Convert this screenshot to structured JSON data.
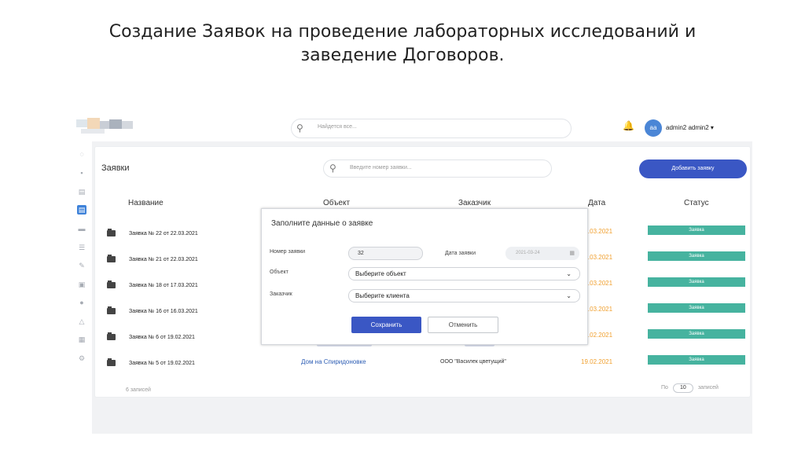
{
  "slide": {
    "title_line1": "Создание Заявок на проведение лабораторных исследований и",
    "title_line2": "заведение Договоров."
  },
  "topbar": {
    "search_placeholder": "Найдется все...",
    "avatar_initials": "aa",
    "username": "admin2 admin2 ▾"
  },
  "sidebar": {
    "icons": [
      "spinner-icon",
      "box-icon",
      "chart-icon",
      "document-icon",
      "folder-icon",
      "list-icon",
      "edit-icon",
      "archive-icon",
      "users-icon",
      "network-icon",
      "calendar-icon",
      "gear-icon"
    ],
    "active_index": 3
  },
  "page": {
    "title": "Заявки",
    "search_placeholder": "Введите номер заявки...",
    "add_button": "Добавить заявку"
  },
  "table": {
    "headers": [
      "Название",
      "Объект",
      "Заказчик",
      "Дата",
      "Статус"
    ],
    "rows": [
      {
        "name": "Заявка № 22 от 22.03.2021",
        "date": "22.03.2021",
        "status": "Заявка"
      },
      {
        "name": "Заявка № 21 от 22.03.2021",
        "date": "22.03.2021",
        "status": "Заявка"
      },
      {
        "name": "Заявка № 18 от 17.03.2021",
        "date": "17.03.2021",
        "status": "Заявка"
      },
      {
        "name": "Заявка № 16 от 16.03.2021",
        "date": "16.03.2021",
        "status": "Заявка"
      },
      {
        "name": "Заявка № 6 от 19.02.2021",
        "date": "19.02.2021",
        "status": "Заявка"
      },
      {
        "name": "Заявка № 5 от 19.02.2021",
        "object": "Дом на Спиридоновке",
        "client": "ООО \"Василек цветущий\"",
        "date": "19.02.2021",
        "status": "Заявка"
      }
    ],
    "footer_count": "6 записей",
    "footer_per_prefix": "По",
    "footer_per_value": "10",
    "footer_per_suffix": "записей"
  },
  "modal": {
    "title": "Заполните данные о заявке",
    "number_label": "Номер заявки",
    "number_value": "32",
    "date_label": "Дата заявки",
    "date_value": "2021-03-24",
    "object_label": "Объект",
    "object_value": "Выберите объект",
    "client_label": "Заказчик",
    "client_value": "Выберите клиента",
    "save_button": "Сохранить",
    "cancel_button": "Отменить"
  },
  "colors": {
    "primary": "#3a57c4",
    "status": "#46b39f",
    "date": "#f0a030",
    "link": "#2f5fb5"
  }
}
